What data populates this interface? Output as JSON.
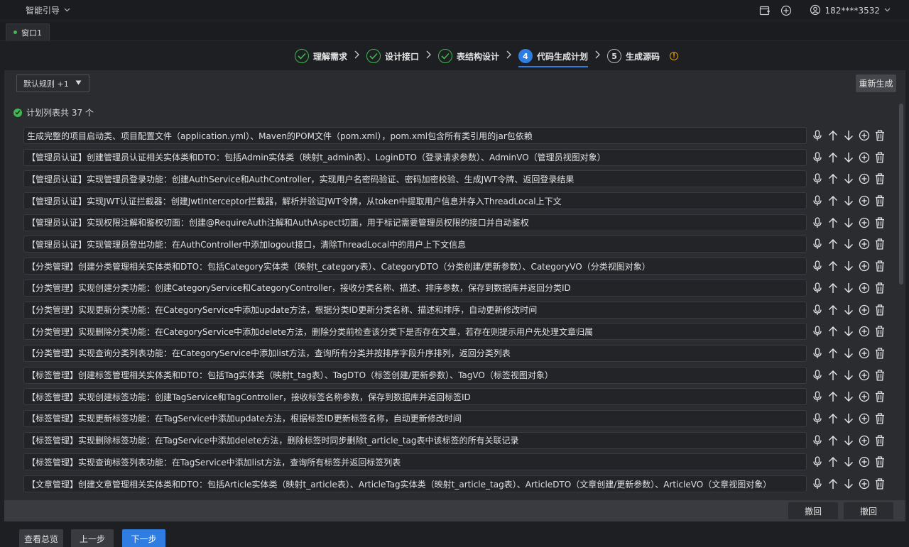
{
  "app": {
    "title": "智能引导"
  },
  "user": {
    "name": "182****3532"
  },
  "tabs": [
    {
      "label": "窗口1"
    }
  ],
  "steps": [
    {
      "label": "理解需求",
      "state": "done"
    },
    {
      "label": "设计接口",
      "state": "done"
    },
    {
      "label": "表结构设计",
      "state": "done"
    },
    {
      "number": "4",
      "label": "代码生成计划",
      "state": "current"
    },
    {
      "number": "5",
      "label": "生成源码",
      "state": "future"
    }
  ],
  "toolbar": {
    "rule_select": "默认规则 +1",
    "regen_label": "重新生成"
  },
  "plan": {
    "count_text": "计划列表共 37 个",
    "items": [
      "生成完整的项目启动类、项目配置文件（application.yml）、Maven的POM文件（pom.xml），pom.xml包含所有类引用的jar包依赖",
      "【管理员认证】创建管理员认证相关实体类和DTO：包括Admin实体类（映射t_admin表）、LoginDTO（登录请求参数）、AdminVO（管理员视图对象）",
      "【管理员认证】实现管理员登录功能：创建AuthService和AuthController，实现用户名密码验证、密码加密校验、生成JWT令牌、返回登录结果",
      "【管理员认证】实现JWT认证拦截器：创建JwtInterceptor拦截器，解析并验证JWT令牌，从token中提取用户信息并存入ThreadLocal上下文",
      "【管理员认证】实现权限注解和鉴权切面：创建@RequireAuth注解和AuthAspect切面，用于标记需要管理员权限的接口并自动鉴权",
      "【管理员认证】实现管理员登出功能：在AuthController中添加logout接口，清除ThreadLocal中的用户上下文信息",
      "【分类管理】创建分类管理相关实体类和DTO：包括Category实体类（映射t_category表）、CategoryDTO（分类创建/更新参数）、CategoryVO（分类视图对象）",
      "【分类管理】实现创建分类功能：创建CategoryService和CategoryController，接收分类名称、描述、排序参数，保存到数据库并返回分类ID",
      "【分类管理】实现更新分类功能：在CategoryService中添加update方法，根据分类ID更新分类名称、描述和排序，自动更新修改时间",
      "【分类管理】实现删除分类功能：在CategoryService中添加delete方法，删除分类前检查该分类下是否存在文章，若存在则提示用户先处理文章归属",
      "【分类管理】实现查询分类列表功能：在CategoryService中添加list方法，查询所有分类并按排序字段升序排列，返回分类列表",
      "【标签管理】创建标签管理相关实体类和DTO：包括Tag实体类（映射t_tag表）、TagDTO（标签创建/更新参数）、TagVO（标签视图对象）",
      "【标签管理】实现创建标签功能：创建TagService和TagController，接收标签名称参数，保存到数据库并返回标签ID",
      "【标签管理】实现更新标签功能：在TagService中添加update方法，根据标签ID更新标签名称，自动更新修改时间",
      "【标签管理】实现删除标签功能：在TagService中添加delete方法，删除标签时同步删除t_article_tag表中该标签的所有关联记录",
      "【标签管理】实现查询标签列表功能：在TagService中添加list方法，查询所有标签并返回标签列表",
      "【文章管理】创建文章管理相关实体类和DTO：包括Article实体类（映射t_article表）、ArticleTag实体类（映射t_article_tag表）、ArticleDTO（文章创建/更新参数）、ArticleVO（文章视图对象）"
    ]
  },
  "bottom": {
    "undo1": "撤回",
    "undo2": "撤回"
  },
  "footer": {
    "overview": "查看总览",
    "prev": "上一步",
    "next": "下一步"
  }
}
